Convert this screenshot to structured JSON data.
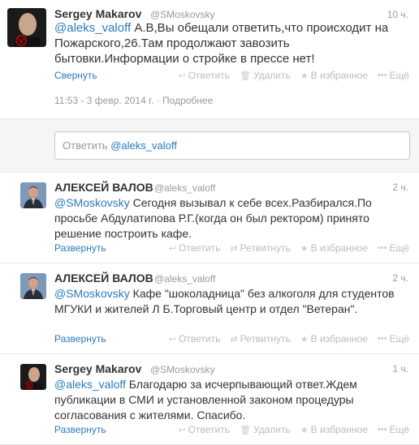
{
  "main_tweet": {
    "name": "Sergey Makarov",
    "handle": "@SMoskovsky",
    "time": "10 ч.",
    "mention": "@aleks_valoff",
    "text": " А.В,Вы обещали ответить,что происходит на Пожарского,26.Там продолжают завозить бытовки.Информации о стройке в прессе нет!",
    "collapse_label": "Свернуть",
    "actions": {
      "reply": "Ответить",
      "delete": "Удалить",
      "favorite": "В избранное",
      "more": "Ещё"
    },
    "meta_datetime": "11:53 - 3 февр. 2014 г.",
    "meta_separator": " · ",
    "meta_details": "Подробнее"
  },
  "reply_box": {
    "prefix": "Ответить",
    "mention": "@aleks_valoff"
  },
  "replies": [
    {
      "name": "АЛЕКСЕЙ ВАЛОВ",
      "handle": "@aleks_valoff",
      "time": "2 ч.",
      "mention": "@SMoskovsky",
      "text": " Сегодня вызывал к себе всех.Разбирался.По просьбе Абдулатипова Р.Г.(когда он был ректором) принято решение построить кафе.",
      "expand_label": "Развернуть",
      "actions": {
        "reply": "Ответить",
        "retweet": "Ретвитнуть",
        "favorite": "В избранное",
        "more": "Ещё"
      }
    },
    {
      "name": "АЛЕКСЕЙ ВАЛОВ",
      "handle": "@aleks_valoff",
      "time": "2 ч.",
      "mention": "@SMoskovsky",
      "text": " Кафе \"шоколадница\" без алкоголя для студентов МГУКИ и жителей Л Б.Торговый центр и отдел \"Ветеран\".",
      "expand_label": "Развернуть",
      "actions": {
        "reply": "Ответить",
        "retweet": "Ретвитнуть",
        "favorite": "В избранное",
        "more": "Ещё"
      }
    },
    {
      "name": "Sergey Makarov",
      "handle": "@SMoskovsky",
      "time": "1 ч.",
      "mention": "@aleks_valoff",
      "text": " Благодарю за исчерпывающий ответ.Ждем публикации в СМИ и установленной законом процедуры согласования с жителями. Спасибо.",
      "expand_label": "Развернуть",
      "actions": {
        "reply": "Ответить",
        "delete": "Удалить",
        "favorite": "В избранное",
        "more": "Ещё"
      }
    }
  ],
  "colors": {
    "link": "#2b7bb9",
    "muted": "#999999",
    "reply_bg": "#f5f5f5"
  },
  "icons": [
    "reply-icon",
    "trash-icon",
    "star-icon",
    "ellipsis-icon",
    "retweet-icon"
  ]
}
